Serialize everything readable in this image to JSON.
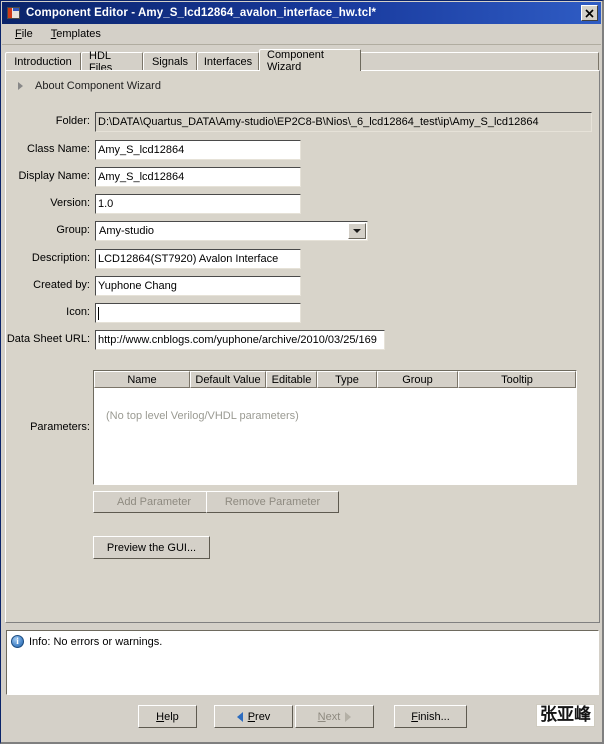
{
  "window": {
    "title": "Component Editor - Amy_S_lcd12864_avalon_interface_hw.tcl*",
    "app_icon": "component-editor-icon",
    "close_label": "✖"
  },
  "menubar": {
    "items": [
      {
        "label_pre": "",
        "mnemonic": "F",
        "label_post": "ile"
      },
      {
        "label_pre": "",
        "mnemonic": "T",
        "label_post": "emplates"
      }
    ]
  },
  "tabs": [
    {
      "label": "Introduction",
      "active": false
    },
    {
      "label": "HDL Files",
      "active": false
    },
    {
      "label": "Signals",
      "active": false
    },
    {
      "label": "Interfaces",
      "active": false
    },
    {
      "label": "Component Wizard",
      "active": true
    }
  ],
  "about": {
    "label": "About Component Wizard",
    "expanded": false
  },
  "form": {
    "folder": {
      "label": "Folder:",
      "value": "D:\\DATA\\Quartus_DATA\\Amy-studio\\EP2C8-B\\Nios\\_6_lcd12864_test\\ip\\Amy_S_lcd12864",
      "readonly": true
    },
    "class_name": {
      "label": "Class Name:",
      "value": "Amy_S_lcd12864"
    },
    "display_name": {
      "label": "Display Name:",
      "value": "Amy_S_lcd12864"
    },
    "version": {
      "label": "Version:",
      "value": "1.0"
    },
    "group": {
      "label": "Group:",
      "value": "Amy-studio",
      "options": [
        "Amy-studio"
      ]
    },
    "description": {
      "label": "Description:",
      "value": "LCD12864(ST7920) Avalon Interface"
    },
    "created_by": {
      "label": "Created by:",
      "value": "Yuphone Chang"
    },
    "icon": {
      "label": "Icon:",
      "value": "",
      "focused": true
    },
    "data_sheet_url": {
      "label": "Data Sheet URL:",
      "value": "http://www.cnblogs.com/yuphone/archive/2010/03/25/169"
    }
  },
  "parameters": {
    "label": "Parameters:",
    "columns": [
      "Name",
      "Default Value",
      "Editable",
      "Type",
      "Group",
      "Tooltip"
    ],
    "empty_message": "(No top level Verilog/VHDL parameters)",
    "rows": [],
    "add_button": {
      "label": "Add Parameter",
      "disabled": true
    },
    "remove_button": {
      "label": "Remove Parameter",
      "disabled": true
    }
  },
  "preview_button": {
    "label": "Preview the GUI..."
  },
  "message_pane": {
    "icon": "info-icon",
    "icon_glyph": "i",
    "text": "Info: No errors or warnings."
  },
  "footer": {
    "help": {
      "pre": "",
      "mnemonic": "H",
      "post": "elp",
      "disabled": false
    },
    "prev": {
      "pre": "",
      "mnemonic": "P",
      "post": "rev",
      "disabled": false,
      "icon": "arrow-left-icon"
    },
    "next": {
      "pre": "",
      "mnemonic": "N",
      "post": "ext",
      "disabled": true,
      "icon": "arrow-right-icon"
    },
    "finish": {
      "pre": "",
      "mnemonic": "F",
      "post": "inish...",
      "disabled": false
    },
    "watermark": "张亚峰"
  },
  "colors": {
    "title_bar": "#0a246a",
    "panel": "#d8d4ca",
    "control": "#d4d0c8",
    "field": "#ffffff",
    "info_accent": "#4a87c9",
    "disabled_text": "#8e8a80"
  }
}
